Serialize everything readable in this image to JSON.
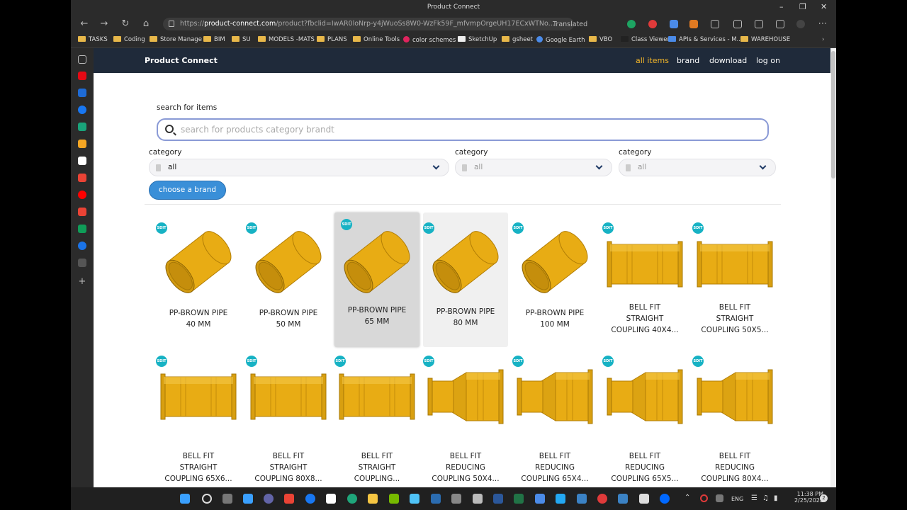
{
  "window": {
    "title": "Product Connect"
  },
  "browser": {
    "url_domain": "product-connect.com",
    "url_prefix": "https://",
    "url_rest": "/product?fbclid=IwAR0loNrp-y4jWuoSs8W0-WzFk59F_mfvmpOrgeUH17ECxWTNo...",
    "translated": "Translated"
  },
  "bookmarks": [
    "TASKS",
    "Coding",
    "Store Manage",
    "BIM",
    "SU",
    "MODELS -MATS",
    "PLANS",
    "Online Tools",
    "color schemes",
    "SketchUp",
    "gsheet",
    "Google Earth",
    "VBO",
    "Class Viewer",
    "APIs & Services - M...",
    "WAREHOUSE"
  ],
  "site": {
    "brand": "Product Connect",
    "nav": [
      "all items",
      "brand",
      "download",
      "log on"
    ],
    "search_label": "search for items",
    "search_placeholder": "search for products category brandt",
    "filters": [
      {
        "label": "category",
        "value": "all"
      },
      {
        "label": "category",
        "value": "all"
      },
      {
        "label": "category",
        "value": "all"
      }
    ],
    "choose_brand": "choose a brand",
    "brand_logo_text": "SDIT"
  },
  "products": [
    {
      "line1": "PP-BROWN PIPE",
      "line2": "40 MM",
      "line3": "",
      "kind": "pipe"
    },
    {
      "line1": "PP-BROWN PIPE",
      "line2": "50 MM",
      "line3": "",
      "kind": "pipe"
    },
    {
      "line1": "PP-BROWN PIPE",
      "line2": "65 MM",
      "line3": "",
      "kind": "pipe"
    },
    {
      "line1": "PP-BROWN PIPE",
      "line2": "80 MM",
      "line3": "",
      "kind": "pipe"
    },
    {
      "line1": "PP-BROWN PIPE",
      "line2": "100 MM",
      "line3": "",
      "kind": "pipe"
    },
    {
      "line1": "BELL FIT",
      "line2": "STRAIGHT",
      "line3": "COUPLING 40X4...",
      "kind": "straight"
    },
    {
      "line1": "BELL FIT",
      "line2": "STRAIGHT",
      "line3": "COUPLING 50X5...",
      "kind": "straight"
    },
    {
      "line1": "BELL FIT",
      "line2": "STRAIGHT",
      "line3": "COUPLING 65X6...",
      "kind": "straight"
    },
    {
      "line1": "BELL FIT",
      "line2": "STRAIGHT",
      "line3": "COUPLING 80X8...",
      "kind": "straight"
    },
    {
      "line1": "BELL FIT",
      "line2": "STRAIGHT",
      "line3": "COUPLING...",
      "kind": "straight"
    },
    {
      "line1": "BELL FIT",
      "line2": "REDUCING",
      "line3": "COUPLING 50X4...",
      "kind": "reducing"
    },
    {
      "line1": "BELL FIT",
      "line2": "REDUCING",
      "line3": "COUPLING 65X4...",
      "kind": "reducing"
    },
    {
      "line1": "BELL FIT",
      "line2": "REDUCING",
      "line3": "COUPLING 65X5...",
      "kind": "reducing"
    },
    {
      "line1": "BELL FIT",
      "line2": "REDUCING",
      "line3": "COUPLING 80X4...",
      "kind": "reducing"
    }
  ],
  "taskbar": {
    "lang": "ENG",
    "time": "11:38 PM",
    "date": "2/25/2022",
    "notif": "2"
  },
  "colors": {
    "accent": "#f0b429",
    "navbar": "#1f2a3a",
    "button": "#3a8fd8",
    "pipe": "#e8ac14",
    "logo": "#17b2c4"
  }
}
